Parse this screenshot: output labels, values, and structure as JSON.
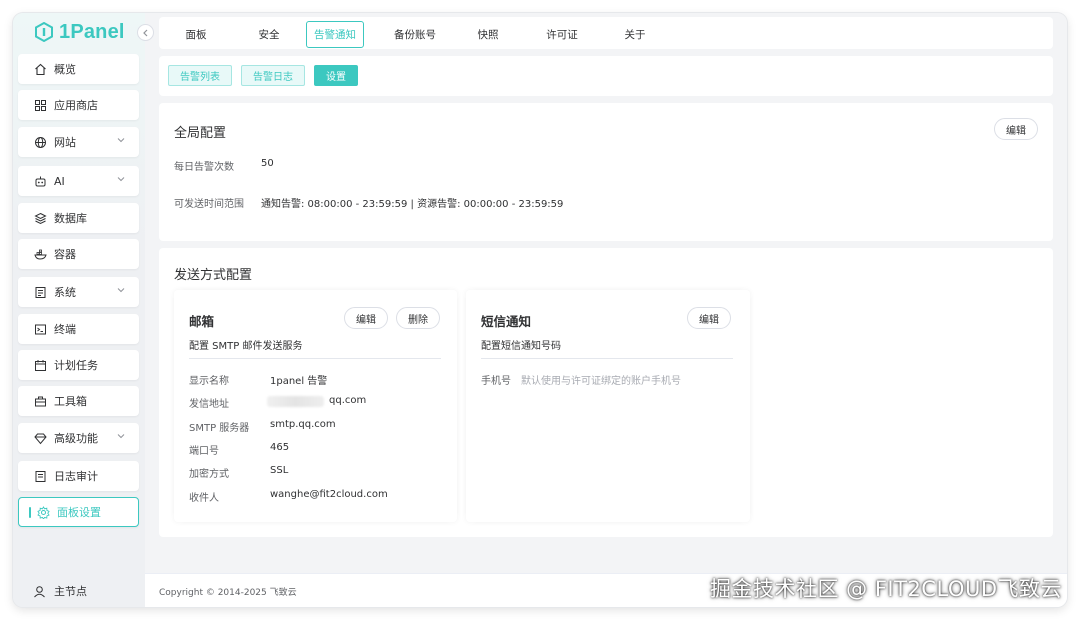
{
  "app": {
    "logo_text": "1Panel"
  },
  "sidebar": {
    "items": [
      {
        "label": "概览",
        "icon": "home-icon"
      },
      {
        "label": "应用商店",
        "icon": "grid-icon"
      },
      {
        "label": "网站",
        "icon": "globe-icon"
      },
      {
        "label": "AI",
        "icon": "robot-icon"
      },
      {
        "label": "数据库",
        "icon": "database-icon"
      },
      {
        "label": "容器",
        "icon": "docker-icon"
      },
      {
        "label": "系统",
        "icon": "system-icon"
      },
      {
        "label": "终端",
        "icon": "terminal-icon"
      },
      {
        "label": "计划任务",
        "icon": "calendar-icon"
      },
      {
        "label": "工具箱",
        "icon": "toolbox-icon"
      },
      {
        "label": "高级功能",
        "icon": "diamond-icon"
      },
      {
        "label": "日志审计",
        "icon": "log-icon"
      },
      {
        "label": "面板设置",
        "icon": "gear-icon"
      }
    ],
    "node_label": "主节点"
  },
  "tabs": [
    "面板",
    "安全",
    "告警通知",
    "备份账号",
    "快照",
    "许可证",
    "关于"
  ],
  "subtabs": [
    "告警列表",
    "告警日志",
    "设置"
  ],
  "global": {
    "title": "全局配置",
    "edit_label": "编辑",
    "daily_label": "每日告警次数",
    "daily_value": "50",
    "time_label": "可发送时间范围",
    "time_value": "通知告警: 08:00:00 - 23:59:59 | 资源告警: 00:00:00 - 23:59:59"
  },
  "send": {
    "title": "发送方式配置",
    "email": {
      "title": "邮箱",
      "edit_label": "编辑",
      "delete_label": "删除",
      "desc": "配置 SMTP 邮件发送服务",
      "rows": [
        {
          "label": "显示名称",
          "value": "1panel 告警"
        },
        {
          "label": "发信地址",
          "value": "qq.com"
        },
        {
          "label": "SMTP 服务器",
          "value": "smtp.qq.com"
        },
        {
          "label": "端口号",
          "value": "465"
        },
        {
          "label": "加密方式",
          "value": "SSL"
        },
        {
          "label": "收件人",
          "value": "wanghe@fit2cloud.com"
        }
      ]
    },
    "sms": {
      "title": "短信通知",
      "edit_label": "编辑",
      "desc": "配置短信通知号码",
      "phone_label": "手机号",
      "phone_placeholder": "默认使用与许可证绑定的账户手机号"
    }
  },
  "footer": {
    "copyright": "Copyright © 2014-2025 飞致云"
  },
  "watermark": "掘金技术社区 @ FIT2CLOUD飞致云",
  "colors": {
    "accent": "#3cc8c0"
  }
}
